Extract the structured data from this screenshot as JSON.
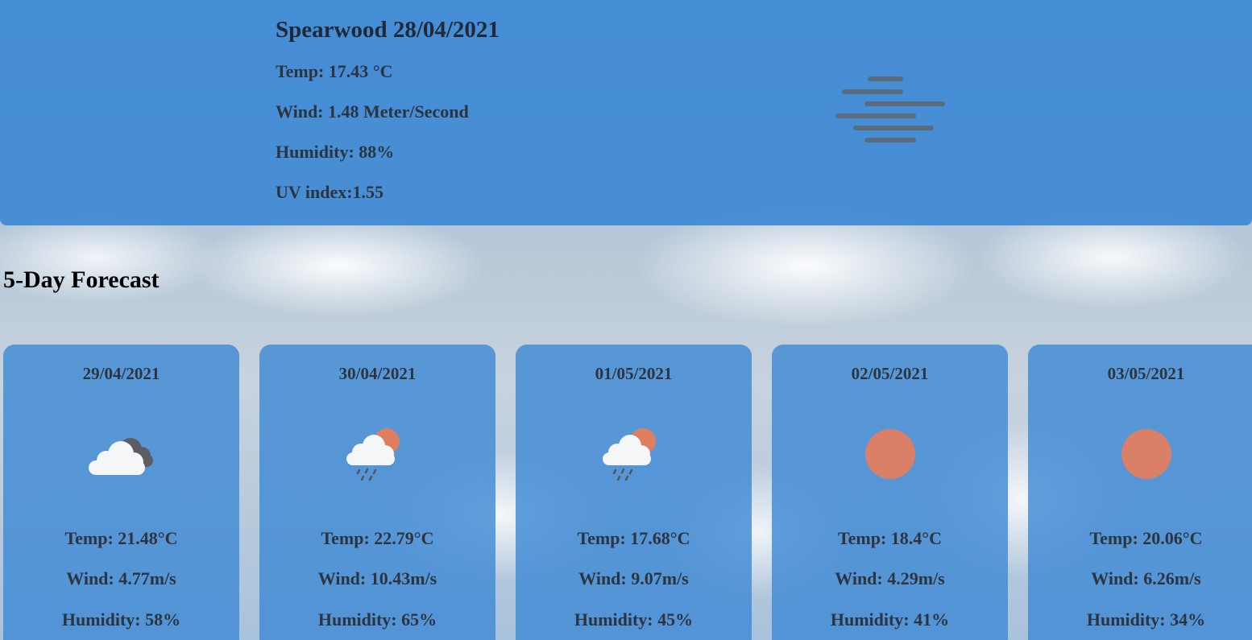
{
  "current": {
    "title": "Spearwood 28/04/2021",
    "temp": "Temp: 17.43 °C",
    "wind": "Wind: 1.48 Meter/Second",
    "humidity": "Humidity: 88%",
    "uv": "UV index:1.55",
    "icon": "mist-icon"
  },
  "forecast": {
    "heading": "5-Day Forecast",
    "days": [
      {
        "date": "29/04/2021",
        "icon": "broken-clouds-icon",
        "temp": "Temp: 21.48°C",
        "wind": "Wind: 4.77m/s",
        "humidity": "Humidity: 58%"
      },
      {
        "date": "30/04/2021",
        "icon": "rain-icon",
        "temp": "Temp: 22.79°C",
        "wind": "Wind: 10.43m/s",
        "humidity": "Humidity: 65%"
      },
      {
        "date": "01/05/2021",
        "icon": "rain-icon",
        "temp": "Temp: 17.68°C",
        "wind": "Wind: 9.07m/s",
        "humidity": "Humidity: 45%"
      },
      {
        "date": "02/05/2021",
        "icon": "clear-sky-icon",
        "temp": "Temp: 18.4°C",
        "wind": "Wind: 4.29m/s",
        "humidity": "Humidity: 41%"
      },
      {
        "date": "03/05/2021",
        "icon": "clear-sky-icon",
        "temp": "Temp: 20.06°C",
        "wind": "Wind: 6.26m/s",
        "humidity": "Humidity: 34%"
      }
    ]
  },
  "colors": {
    "panel": "#408ad4",
    "sun": "#e07e60",
    "cloud_dark": "#5f6166",
    "text": "#2c3440"
  }
}
